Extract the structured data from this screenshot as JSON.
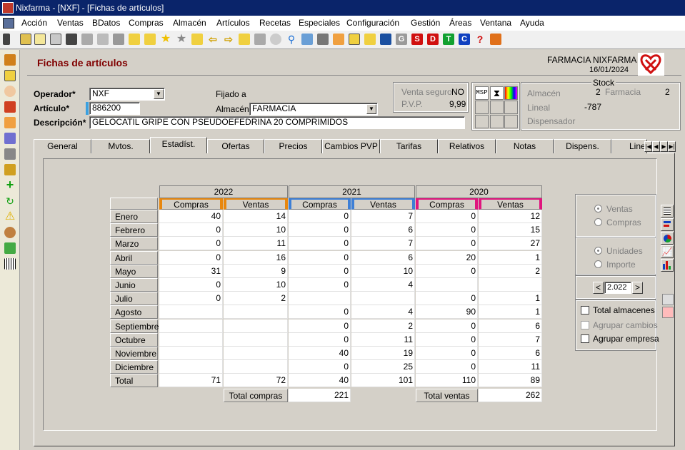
{
  "window": {
    "title": "Nixfarma - [NXF] - [Fichas de artículos]"
  },
  "menu": [
    "Acción",
    "Ventas",
    "BDatos",
    "Compras",
    "Almacén",
    "Artículos",
    "Recetas",
    "Especiales",
    "Configuración",
    "Gestión",
    "Áreas",
    "Ventana",
    "Ayuda"
  ],
  "toolbar": {
    "letters": [
      "G",
      "S",
      "D",
      "T",
      "C",
      "?"
    ]
  },
  "header": {
    "title": "Fichas de artículos",
    "pharmacy": "FARMACIA NIXFARMA",
    "date": "16/01/2024"
  },
  "form": {
    "operador_label": "Operador*",
    "operador_value": "NXF",
    "articulo_label": "Artículo*",
    "articulo_value": "886200",
    "descripcion_label": "Descripción*",
    "descripcion_value": "GELOCATIL GRIPE CON PSEUDOEFEDRINA 20 COMPRIMIDOS",
    "fijado_label": "Fijado a",
    "almacen_label": "Almacén",
    "almacen_value": "FARMACIA"
  },
  "prices": {
    "venta_seguro_label": "Venta seguro",
    "venta_seguro_value": "NO",
    "pvp_label": "P.V.P.",
    "pvp_value": "9,99"
  },
  "badges": {
    "msp": "MSP",
    "hourglass": "⧗"
  },
  "stock": {
    "title": "Stock",
    "almacen_label": "Almacén",
    "almacen_value": "2",
    "farmacia_label": "Farmacia",
    "farmacia_value": "2",
    "lineal_label": "Lineal",
    "lineal_value": "-787",
    "dispensador_label": "Dispensador"
  },
  "tabs": [
    "General",
    "Mvtos.",
    "Estadíst.",
    "Ofertas",
    "Precios",
    "Cambios PVP",
    "Tarifas",
    "Relativos",
    "Notas",
    "Dispens.",
    "Line"
  ],
  "active_tab": "Estadíst.",
  "stats": {
    "years": [
      "2022",
      "2021",
      "2020"
    ],
    "col_compras": "Compras",
    "col_ventas": "Ventas",
    "year_colors": [
      "#e8870e",
      "#3d7fd6",
      "#e0157e"
    ],
    "months": [
      "Enero",
      "Febrero",
      "Marzo",
      "Abril",
      "Mayo",
      "Junio",
      "Julio",
      "Agosto",
      "Septiembre",
      "Octubre",
      "Noviembre",
      "Diciembre",
      "Total"
    ],
    "rows": [
      [
        "40",
        "14",
        "0",
        "7",
        "0",
        "12"
      ],
      [
        "0",
        "10",
        "0",
        "6",
        "0",
        "15"
      ],
      [
        "0",
        "11",
        "0",
        "7",
        "0",
        "27"
      ],
      [
        "0",
        "16",
        "0",
        "6",
        "20",
        "1"
      ],
      [
        "31",
        "9",
        "0",
        "10",
        "0",
        "2"
      ],
      [
        "0",
        "10",
        "0",
        "4",
        "",
        ""
      ],
      [
        "0",
        "2",
        "",
        "",
        "0",
        "1"
      ],
      [
        "",
        "",
        "0",
        "4",
        "90",
        "1"
      ],
      [
        "",
        "",
        "0",
        "2",
        "0",
        "6"
      ],
      [
        "",
        "",
        "0",
        "11",
        "0",
        "7"
      ],
      [
        "",
        "",
        "40",
        "19",
        "0",
        "6"
      ],
      [
        "",
        "",
        "0",
        "25",
        "0",
        "11"
      ],
      [
        "71",
        "72",
        "40",
        "101",
        "110",
        "89"
      ]
    ],
    "total_compras_label": "Total compras",
    "total_compras_value": "221",
    "total_ventas_label": "Total ventas",
    "total_ventas_value": "262"
  },
  "options": {
    "ventas": "Ventas",
    "compras": "Compras",
    "unidades": "Unidades",
    "importe": "Importe",
    "year_value": "2.022",
    "prev": "<",
    "next": ">",
    "total_almacenes": "Total almacenes",
    "agrupar_cambios": "Agrupar cambios",
    "agrupar_empresa": "Agrupar empresa"
  }
}
